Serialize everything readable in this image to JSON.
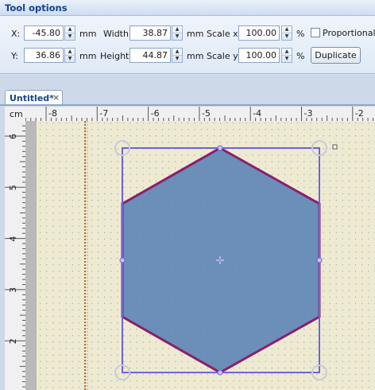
{
  "tool_options": {
    "title": "Tool options",
    "x": {
      "label": "X:",
      "value": "-45.80",
      "unit": "mm"
    },
    "y": {
      "label": "Y:",
      "value": "36.86",
      "unit": "mm"
    },
    "width": {
      "label": "Width:",
      "value": "38.87",
      "unit": "mm"
    },
    "height": {
      "label": "Height:",
      "value": "44.87",
      "unit": "mm"
    },
    "scale_x": {
      "label": "Scale x:",
      "value": "100.00",
      "unit": "%"
    },
    "scale_y": {
      "label": "Scale y:",
      "value": "100.00",
      "unit": "%"
    },
    "proportional": {
      "label": "Proportional",
      "checked": false
    },
    "duplicate_label": "Duplicate"
  },
  "document": {
    "tab_title": "Untitled*",
    "close_glyph": "×",
    "ruler_unit": "cm",
    "h_ticks": [
      "-8",
      "-7",
      "-6",
      "-5",
      "-4",
      "-3",
      "-2"
    ],
    "v_ticks": [
      "6",
      "5",
      "4",
      "3",
      "2"
    ]
  },
  "colors": {
    "canvas_bg": "#eeead2",
    "grid_dot": "#8a8a80",
    "shape_fill": "#5f87b6",
    "shape_stroke": "#8b1e6c",
    "selection": "#6e63d6",
    "guide": "#b0683b"
  }
}
